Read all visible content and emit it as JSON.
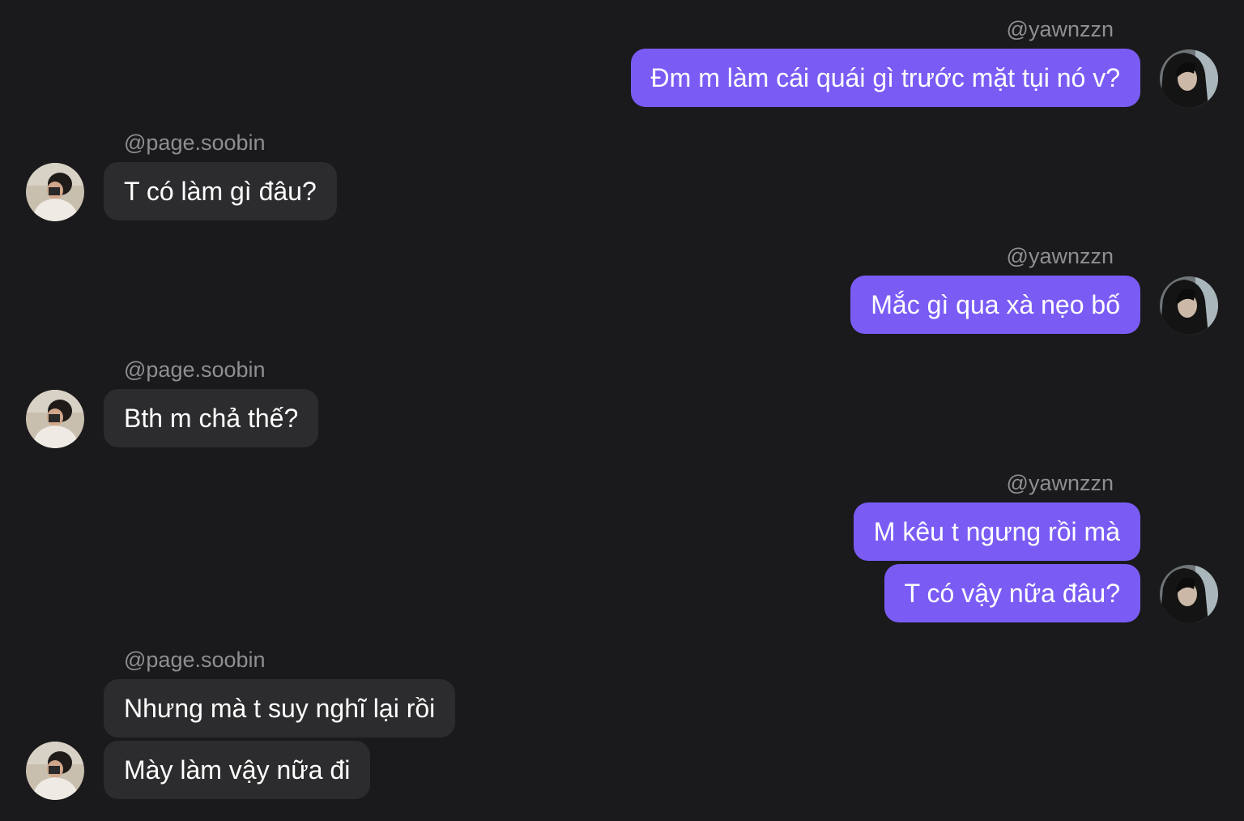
{
  "me": {
    "username": "@yawnzzn"
  },
  "other": {
    "username": "@page.soobin"
  },
  "colors": {
    "background": "#1a1a1c",
    "my_bubble": "#7a5cf5",
    "their_bubble": "#2c2c2e",
    "username_text": "#8e8e93"
  },
  "groups": [
    {
      "sender": "@yawnzzn",
      "messages": [
        "Đm m làm cái quái gì trước mặt tụi nó v?"
      ]
    },
    {
      "sender": "@page.soobin",
      "messages": [
        "T có làm gì đâu?"
      ]
    },
    {
      "sender": "@yawnzzn",
      "messages": [
        "Mắc gì qua xà nẹo bố"
      ]
    },
    {
      "sender": "@page.soobin",
      "messages": [
        "Bth m chả thế?"
      ]
    },
    {
      "sender": "@yawnzzn",
      "messages": [
        "M kêu t ngưng rồi mà",
        "T có vậy nữa đâu?"
      ]
    },
    {
      "sender": "@page.soobin",
      "messages": [
        "Nhưng mà t suy nghĩ lại rồi",
        "Mày làm vậy nữa đi"
      ]
    }
  ]
}
